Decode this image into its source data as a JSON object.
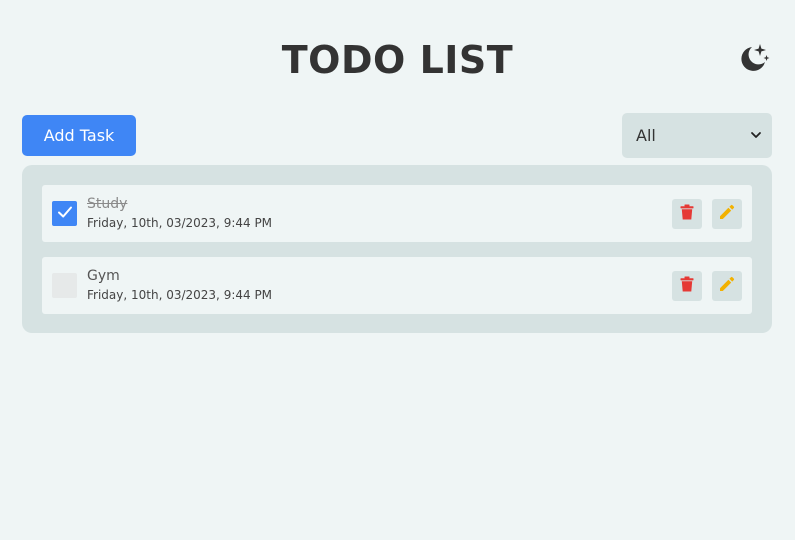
{
  "header": {
    "title": "TODO LIST",
    "theme_icon": "moon-stars-icon"
  },
  "toolbar": {
    "add_label": "Add Task",
    "filter": {
      "selected": "All"
    }
  },
  "tasks": [
    {
      "title": "Study",
      "time": "Friday, 10th, 03/2023, 9:44 PM",
      "completed": true
    },
    {
      "title": "Gym",
      "time": "Friday, 10th, 03/2023, 9:44 PM",
      "completed": false
    }
  ],
  "icons": {
    "delete": "trash-icon",
    "edit": "pencil-icon",
    "check": "checkmark-icon",
    "dropdown": "chevron-down-icon"
  },
  "colors": {
    "background": "#eff5f5",
    "panel": "#d6e2e2",
    "primary": "#3f86f5",
    "delete": "#e53935",
    "edit": "#f2b100",
    "text": "#333333"
  }
}
